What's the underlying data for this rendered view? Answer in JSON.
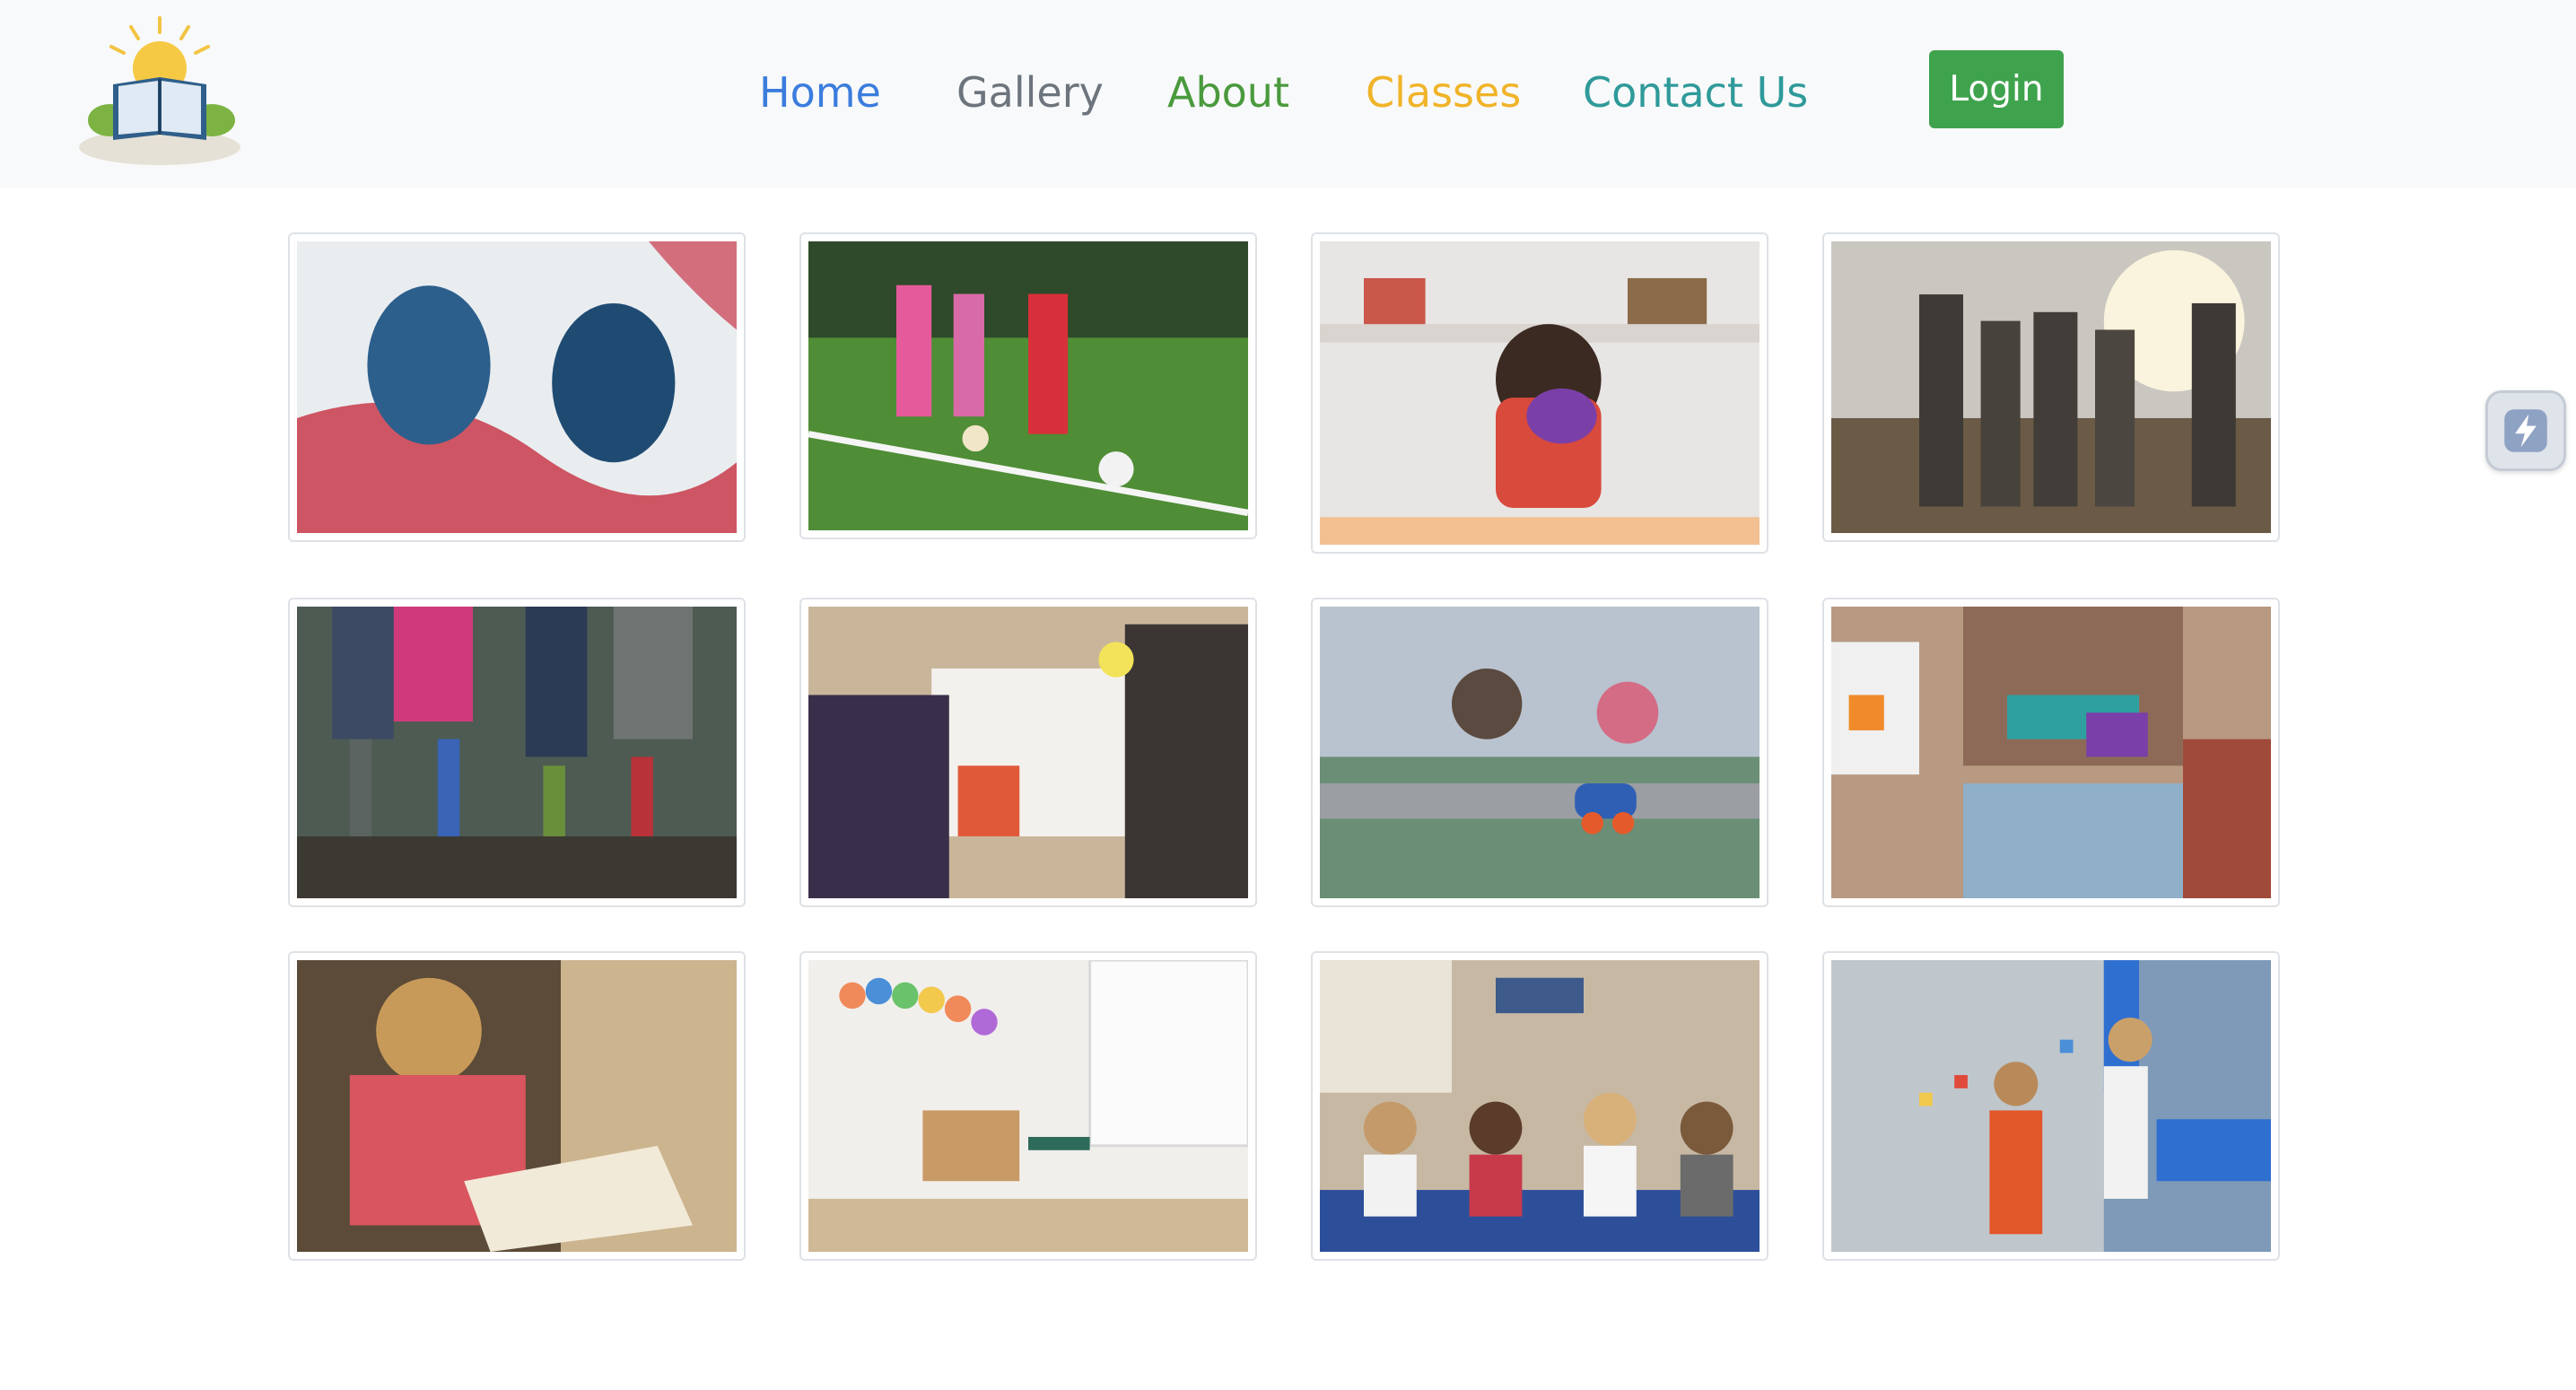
{
  "nav": {
    "links": [
      {
        "label": "Home",
        "color": "#3b7ddd"
      },
      {
        "label": "Gallery",
        "color": "#6c757d"
      },
      {
        "label": "About",
        "color": "#4a9a3d"
      },
      {
        "label": "Classes",
        "color": "#f0b429"
      },
      {
        "label": "Contact Us",
        "color": "#2f9a9a"
      }
    ],
    "login_label": "Login",
    "login_color": "#3fa34d"
  },
  "logo": {
    "icon": "sun-over-book-logo"
  },
  "gallery": {
    "images": [
      {
        "subject": "painted-handprints"
      },
      {
        "subject": "kids-playing-soccer"
      },
      {
        "subject": "toddler-with-toy-camera"
      },
      {
        "subject": "silhouettes-in-sunlight"
      },
      {
        "subject": "kids-in-rain-boots"
      },
      {
        "subject": "children-coloring"
      },
      {
        "subject": "toy-cars-on-playmat"
      },
      {
        "subject": "child-with-building-blocks"
      },
      {
        "subject": "girl-reading-book"
      },
      {
        "subject": "classroom-interior"
      },
      {
        "subject": "children-raising-hands"
      },
      {
        "subject": "kids-at-lego-wall"
      }
    ]
  },
  "side_widget": {
    "icon": "lightning-icon"
  }
}
